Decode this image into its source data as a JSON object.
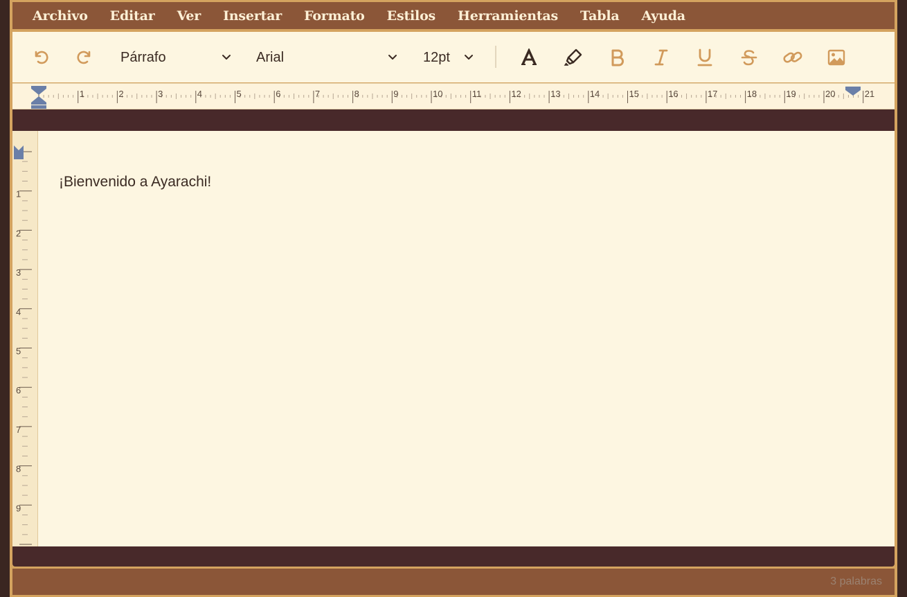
{
  "menu": [
    "Archivo",
    "Editar",
    "Ver",
    "Insertar",
    "Formato",
    "Estilos",
    "Herramientas",
    "Tabla",
    "Ayuda"
  ],
  "toolbar": {
    "paragraph_style": "Párrafo",
    "font_family": "Arial",
    "font_size": "12pt",
    "icons": [
      "undo-icon",
      "redo-icon",
      "text-color-icon",
      "highlight-icon",
      "bold-icon",
      "italic-icon",
      "underline-icon",
      "strikethrough-icon",
      "link-icon",
      "image-icon"
    ]
  },
  "ruler": {
    "horizontal_labels": [
      "1",
      "2",
      "3",
      "4",
      "5",
      "6",
      "7",
      "8",
      "9",
      "10",
      "11",
      "12",
      "13",
      "14",
      "15",
      "16",
      "17",
      "18",
      "19",
      "20",
      "21"
    ],
    "vertical_labels": [
      "1",
      "2",
      "3",
      "4",
      "5",
      "6",
      "7",
      "8",
      "9"
    ]
  },
  "document": {
    "text": "¡Bienvenido a Ayarachi!"
  },
  "status": {
    "word_count": "3 palabras"
  },
  "colors": {
    "menubar": "#8b5638",
    "menu_text": "#fdf0d6",
    "toolbar_bg": "#fdf6e1",
    "accent_icon": "#d19a5b",
    "dark_icon": "#3a2a22",
    "band": "#48292a",
    "frame": "#d4a35f",
    "ruler_marker": "#6a7fa8"
  }
}
